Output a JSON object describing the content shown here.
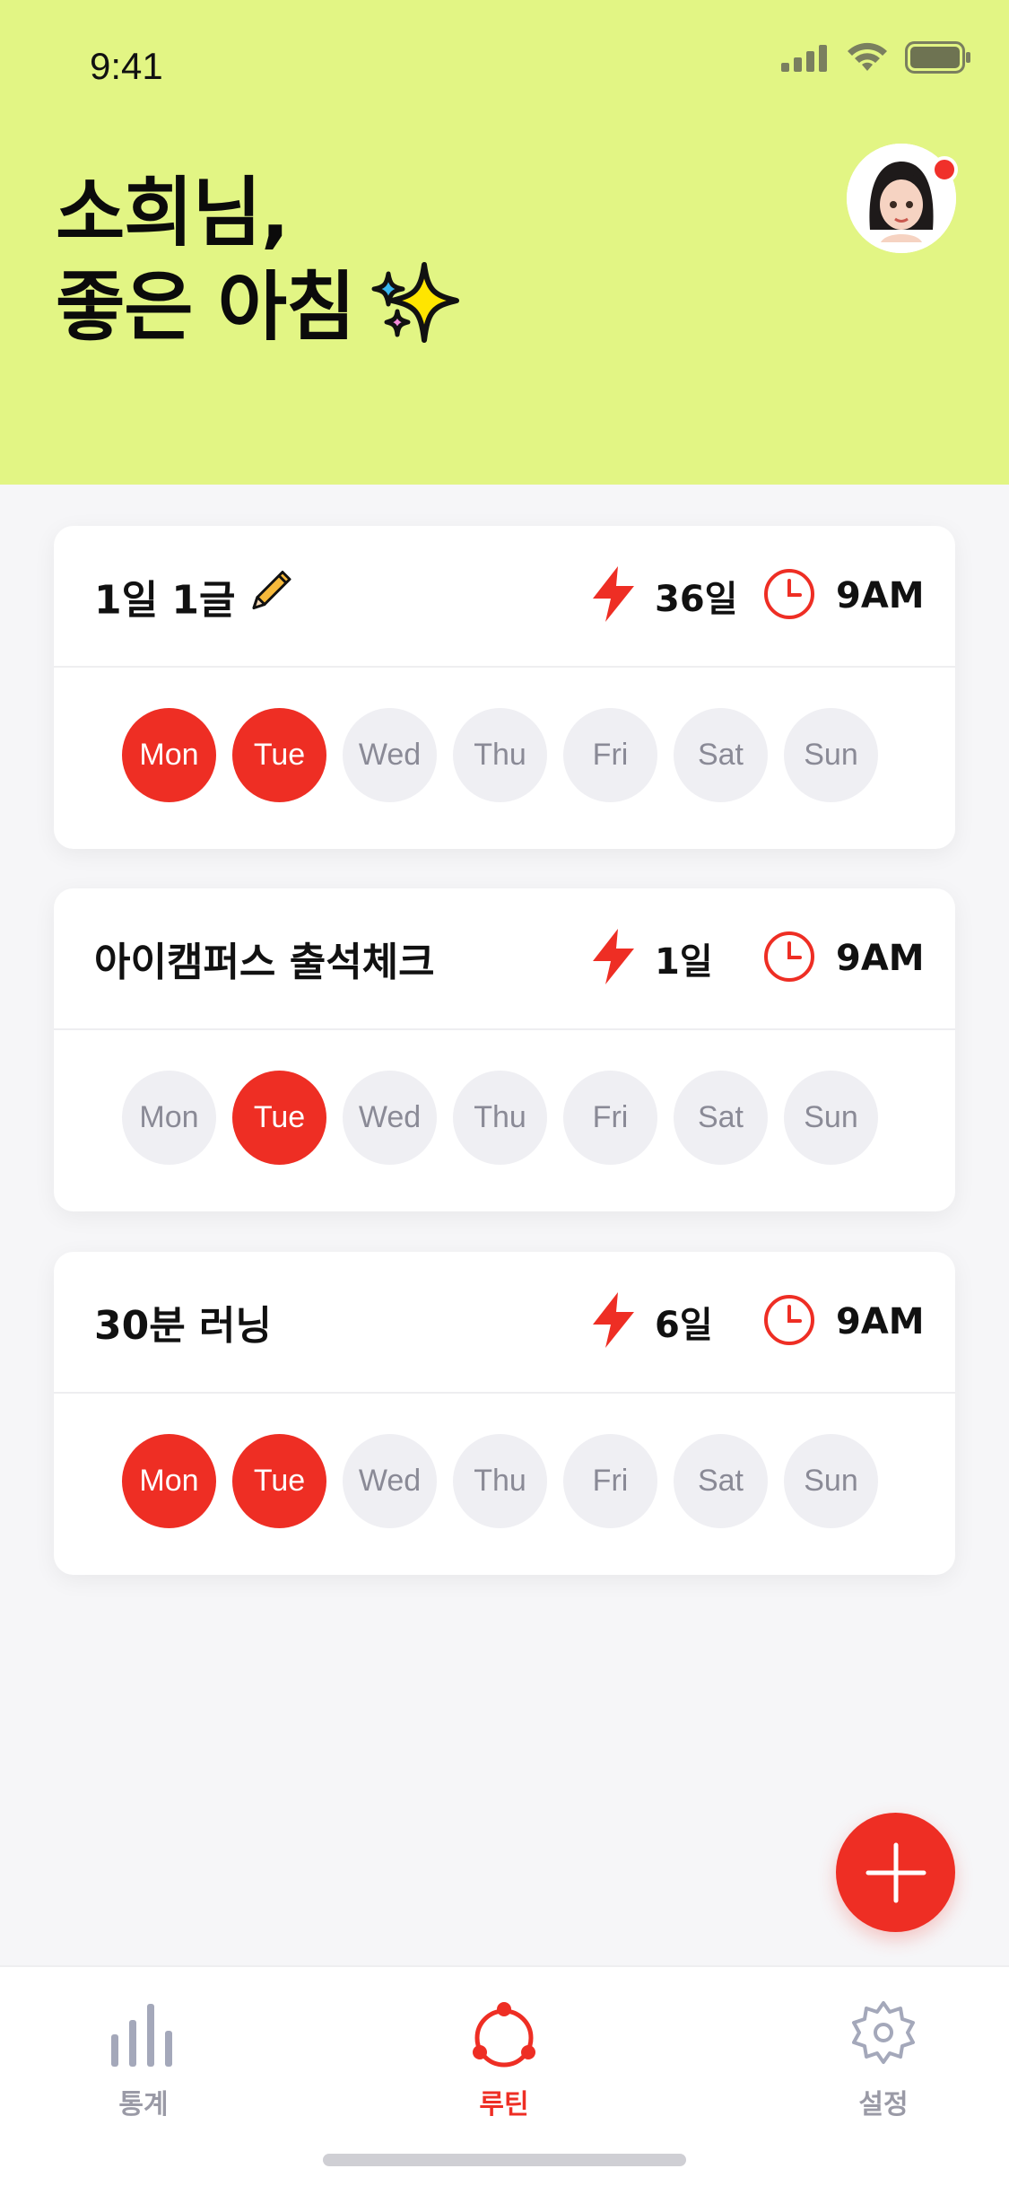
{
  "status_bar": {
    "time": "9:41"
  },
  "header": {
    "greeting_line1": "소희님,",
    "greeting_line2": "좋은 아침",
    "background": "#E2F584"
  },
  "routines": [
    {
      "title": "1일 1글",
      "streak": "36일",
      "time": "9AM",
      "has_pencil": true,
      "days": [
        {
          "label": "Mon",
          "active": true
        },
        {
          "label": "Tue",
          "active": true
        },
        {
          "label": "Wed",
          "active": false
        },
        {
          "label": "Thu",
          "active": false
        },
        {
          "label": "Fri",
          "active": false
        },
        {
          "label": "Sat",
          "active": false
        },
        {
          "label": "Sun",
          "active": false
        }
      ]
    },
    {
      "title": "아이캠퍼스 출석체크",
      "streak": "1일",
      "time": "9AM",
      "has_pencil": false,
      "days": [
        {
          "label": "Mon",
          "active": false
        },
        {
          "label": "Tue",
          "active": true
        },
        {
          "label": "Wed",
          "active": false
        },
        {
          "label": "Thu",
          "active": false
        },
        {
          "label": "Fri",
          "active": false
        },
        {
          "label": "Sat",
          "active": false
        },
        {
          "label": "Sun",
          "active": false
        }
      ]
    },
    {
      "title": "30분 러닝",
      "streak": "6일",
      "time": "9AM",
      "has_pencil": false,
      "days": [
        {
          "label": "Mon",
          "active": true
        },
        {
          "label": "Tue",
          "active": true
        },
        {
          "label": "Wed",
          "active": false
        },
        {
          "label": "Thu",
          "active": false
        },
        {
          "label": "Fri",
          "active": false
        },
        {
          "label": "Sat",
          "active": false
        },
        {
          "label": "Sun",
          "active": false
        }
      ]
    }
  ],
  "tabbar": {
    "tabs": [
      {
        "label": "통계",
        "icon": "bar-chart-icon",
        "active": false
      },
      {
        "label": "루틴",
        "icon": "routine-cycle-icon",
        "active": true
      },
      {
        "label": "설정",
        "icon": "gear-icon",
        "active": false
      }
    ]
  },
  "colors": {
    "accent": "#EE2E24",
    "inactive_day": "#EFEFF3",
    "inactive_text": "#8A8A96"
  }
}
